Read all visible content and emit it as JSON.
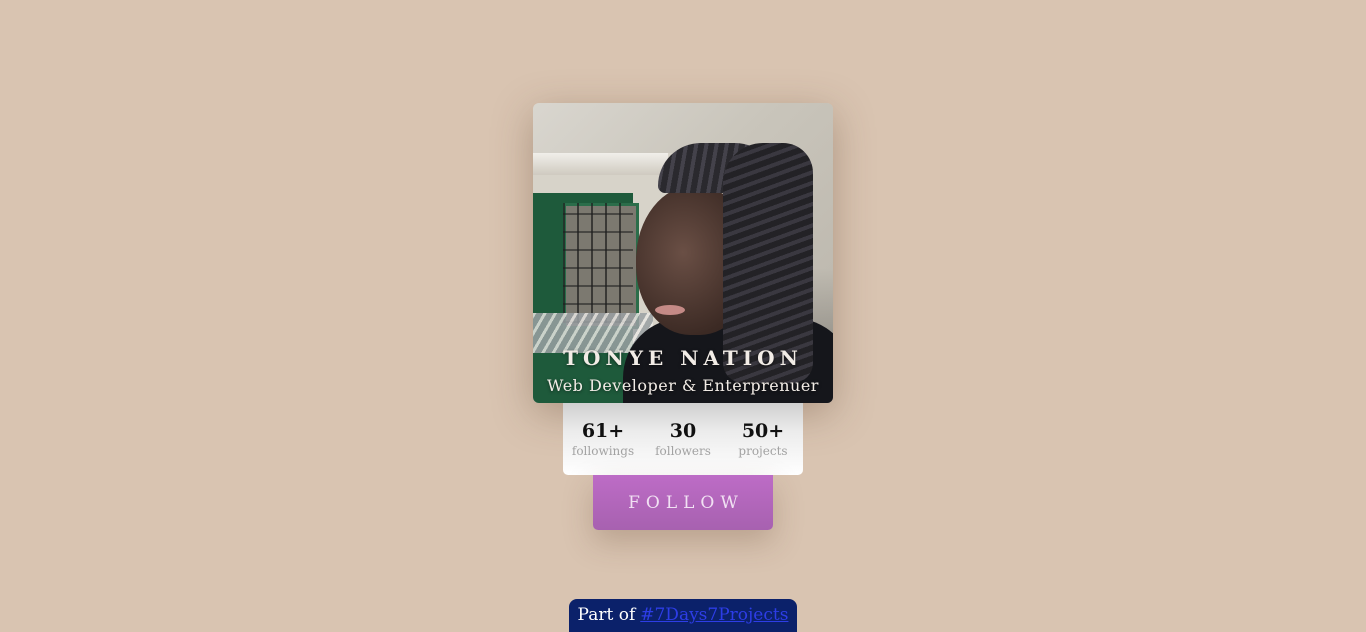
{
  "profile": {
    "name": "TONYE NATION",
    "role": "Web Developer & Enterprenuer",
    "photo_alt": "profile-photo"
  },
  "stats": [
    {
      "value": "61+",
      "label": "followings"
    },
    {
      "value": "30",
      "label": "followers"
    },
    {
      "value": "50+",
      "label": "projects"
    }
  ],
  "actions": {
    "follow_label": "FOLLOW"
  },
  "footer": {
    "prefix": "Part of",
    "link_text": "#7Days7Projects"
  },
  "colors": {
    "background": "#d9c4b1",
    "button": "#b066b9",
    "footer_bg": "#0b216a",
    "link": "#2d3de6"
  }
}
